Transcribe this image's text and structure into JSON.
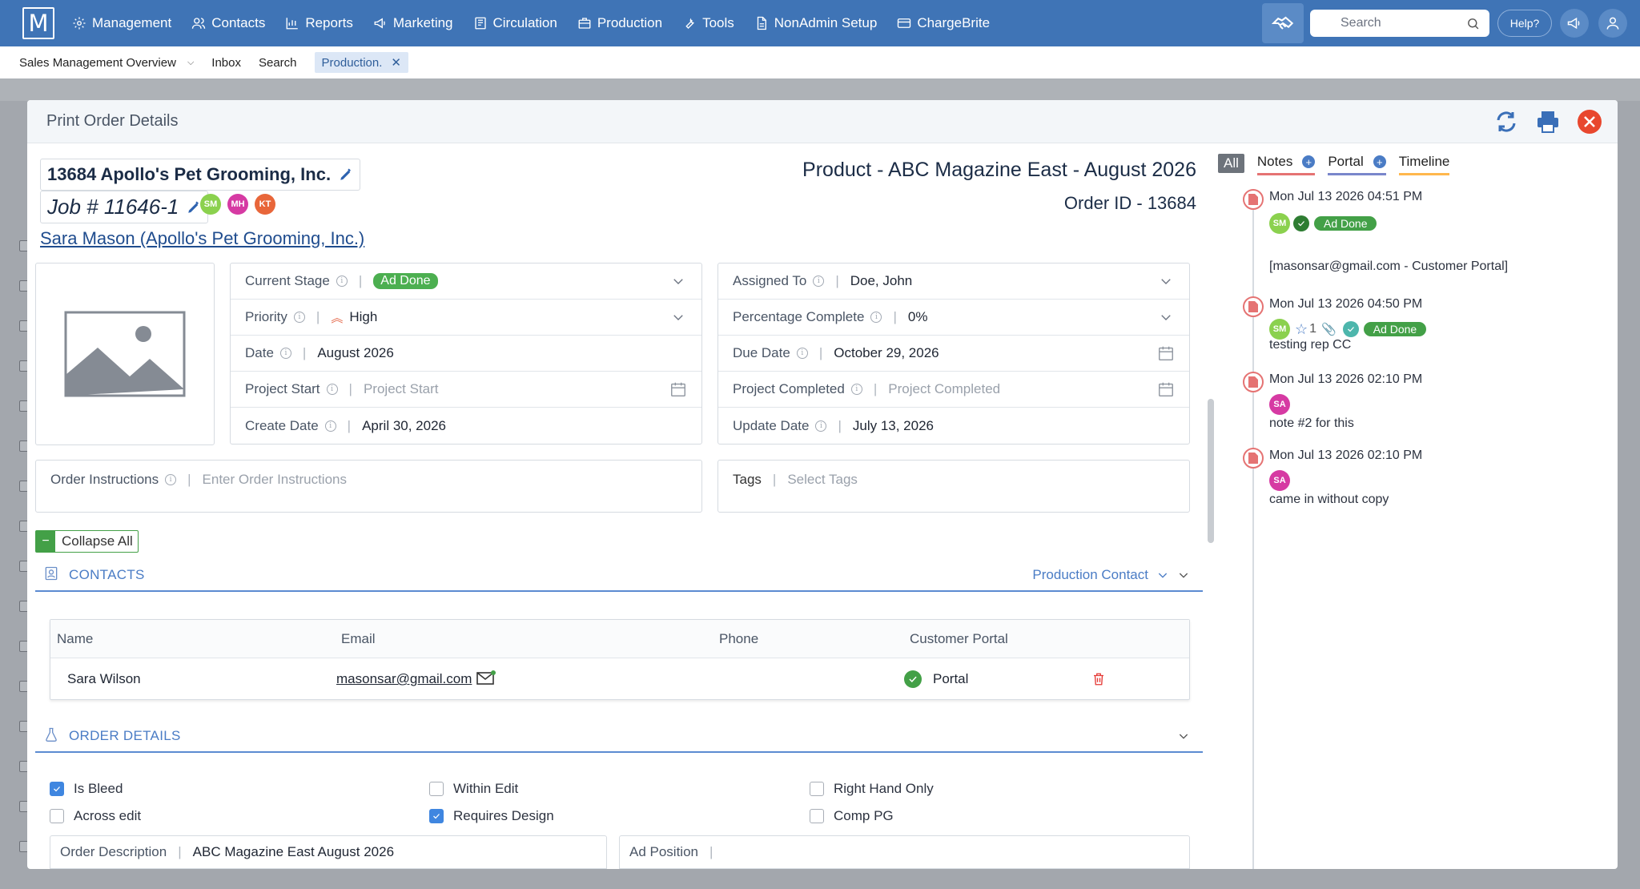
{
  "app": {
    "logo_letter": "M"
  },
  "nav": {
    "items": [
      {
        "label": "Management",
        "icon": "gear-icon"
      },
      {
        "label": "Contacts",
        "icon": "users-icon"
      },
      {
        "label": "Reports",
        "icon": "bar-chart-icon"
      },
      {
        "label": "Marketing",
        "icon": "megaphone-icon"
      },
      {
        "label": "Circulation",
        "icon": "newspaper-icon"
      },
      {
        "label": "Production",
        "icon": "briefcase-icon"
      },
      {
        "label": "Tools",
        "icon": "wrench-icon"
      },
      {
        "label": "NonAdmin Setup",
        "icon": "document-icon"
      },
      {
        "label": "ChargeBrite",
        "icon": "credit-card-icon"
      }
    ],
    "search_placeholder": "Search",
    "help_label": "Help?"
  },
  "tabs": [
    {
      "label": "Sales Management Overview",
      "dropdown": true
    },
    {
      "label": "Inbox"
    },
    {
      "label": "Search"
    },
    {
      "label": "Production.",
      "active": true,
      "closable": true
    }
  ],
  "modal": {
    "title": "Print Order Details",
    "company": "13684 Apollo's Pet Grooming, Inc.",
    "job": "Job # 11646-1",
    "job_avatars": [
      {
        "initials": "SM",
        "color": "#8bd14e"
      },
      {
        "initials": "MH",
        "color": "#d63aa3"
      },
      {
        "initials": "KT",
        "color": "#e8663a"
      }
    ],
    "contact_link": "Sara Mason (Apollo's Pet Grooming, Inc.)",
    "product_title": "Product - ABC Magazine East - August 2026",
    "order_id": "Order ID - 13684",
    "left_fields": {
      "current_stage": {
        "label": "Current Stage",
        "value": "Ad Done"
      },
      "priority": {
        "label": "Priority",
        "value": "High"
      },
      "date": {
        "label": "Date",
        "value": "August 2026"
      },
      "project_start": {
        "label": "Project Start",
        "placeholder": "Project Start"
      },
      "create_date": {
        "label": "Create Date",
        "value": "April 30, 2026"
      }
    },
    "right_fields": {
      "assigned_to": {
        "label": "Assigned To",
        "value": "Doe, John"
      },
      "percentage_complete": {
        "label": "Percentage Complete",
        "value": "0%"
      },
      "due_date": {
        "label": "Due Date",
        "value": "October 29, 2026"
      },
      "project_completed": {
        "label": "Project Completed",
        "placeholder": "Project Completed"
      },
      "update_date": {
        "label": "Update Date",
        "value": "July 13, 2026"
      }
    },
    "order_instructions": {
      "label": "Order Instructions",
      "placeholder": "Enter Order Instructions"
    },
    "tags": {
      "label": "Tags",
      "placeholder": "Select Tags"
    },
    "collapse_all": "Collapse All",
    "contacts_section": {
      "title": "CONTACTS",
      "right_label": "Production Contact",
      "columns": [
        "Name",
        "Email",
        "Phone",
        "Customer Portal"
      ],
      "rows": [
        {
          "name": "Sara Wilson",
          "email": "masonsar@gmail.com",
          "phone": "",
          "portal": "Portal"
        }
      ]
    },
    "order_details_section": {
      "title": "ORDER DETAILS",
      "checkboxes": [
        {
          "label": "Is Bleed",
          "checked": true
        },
        {
          "label": "Within Edit",
          "checked": false
        },
        {
          "label": "Right Hand Only",
          "checked": false
        },
        {
          "label": "Across edit",
          "checked": false
        },
        {
          "label": "Requires Design",
          "checked": true
        },
        {
          "label": "Comp PG",
          "checked": false
        }
      ],
      "order_description": {
        "label": "Order Description",
        "value": "ABC Magazine East August 2026"
      },
      "ad_position": {
        "label": "Ad Position",
        "value": ""
      }
    }
  },
  "activity": {
    "tabs": [
      {
        "label": "All"
      },
      {
        "label": "Notes"
      },
      {
        "label": "Portal"
      },
      {
        "label": "Timeline"
      }
    ],
    "entries": [
      {
        "date": "Mon Jul 13 2026 04:51 PM",
        "avatar": "SM",
        "avatar_color": "#8bd14e",
        "badge": "Ad Done",
        "text": "[masonsar@gmail.com - Customer Portal]"
      },
      {
        "date": "Mon Jul 13 2026 04:50 PM",
        "avatar": "SM",
        "avatar_color": "#8bd14e",
        "count": "1",
        "badge": "Ad Done",
        "text": "testing rep CC"
      },
      {
        "date": "Mon Jul 13 2026 02:10 PM",
        "avatar": "SA",
        "avatar_color": "#d63aa3",
        "text": "note #2 for this"
      },
      {
        "date": "Mon Jul 13 2026 02:10 PM",
        "avatar": "SA",
        "avatar_color": "#d63aa3",
        "text": "came in without copy"
      }
    ]
  },
  "colors": {
    "nav_bg": "#3f74b6",
    "accent": "#4a7cc5",
    "success": "#43a047",
    "danger": "#e53935"
  }
}
